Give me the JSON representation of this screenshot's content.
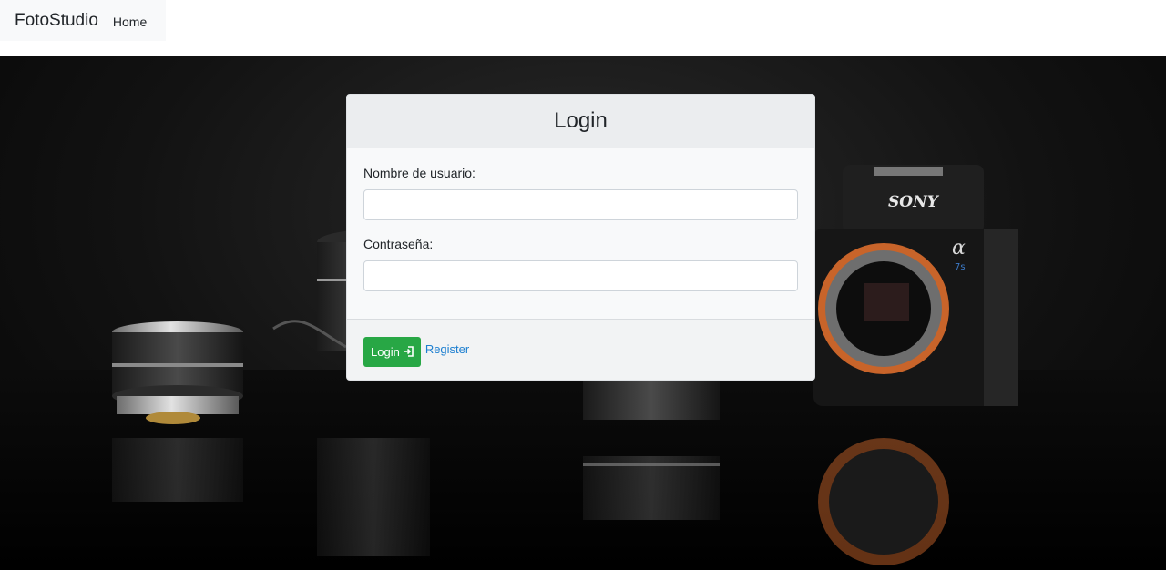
{
  "navbar": {
    "brand": "FotoStudio",
    "links": [
      {
        "label": "Home"
      }
    ]
  },
  "hero": {
    "camera_brand_text": "SONY",
    "camera_model_mark": "α",
    "camera_model_sub": "7s"
  },
  "login_card": {
    "title": "Login",
    "username": {
      "label": "Nombre de usuario:",
      "value": "",
      "placeholder": ""
    },
    "password": {
      "label": "Contraseña:",
      "value": "",
      "placeholder": ""
    },
    "login_button_label": "Login",
    "login_button_icon": "sign-in-icon",
    "register_link_label": "Register"
  },
  "colors": {
    "primary_button": "#28a745",
    "link": "#1e7fd0",
    "camera_mount_ring": "#c8642a"
  }
}
